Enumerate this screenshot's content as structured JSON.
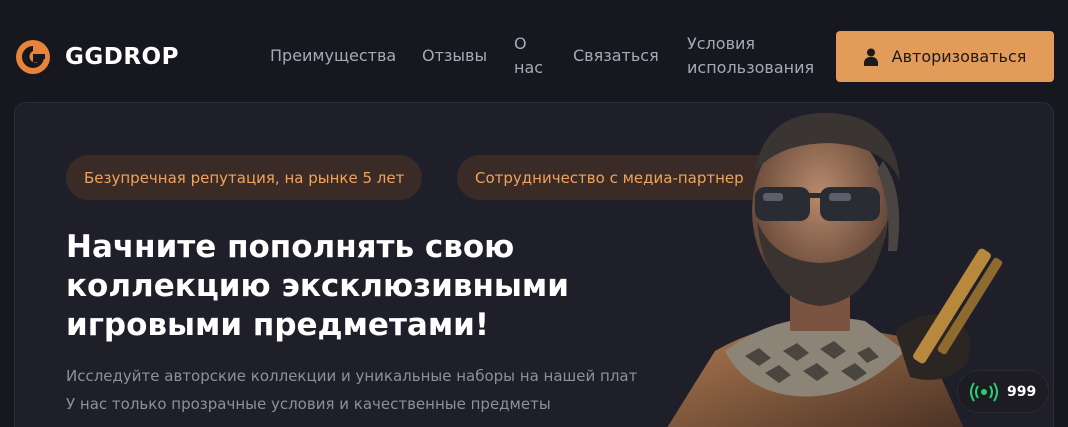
{
  "brand": {
    "name": "GGDROP",
    "accent": "#e39b5a"
  },
  "nav": {
    "advantages": "Преимущества",
    "reviews": "Отзывы",
    "about_line1": "О",
    "about_line2": "нас",
    "contact": "Связаться",
    "terms_line1": "Условия",
    "terms_line2": "использования"
  },
  "login": {
    "label": "Авторизоваться",
    "icon": "user-icon"
  },
  "hero": {
    "badges": [
      "Безупречная репутация, на рынке 5 лет",
      "Сотрудничество с медиа-партнер"
    ],
    "headline": [
      "Начните пополнять свою",
      "коллекцию эксклюзивными",
      "игровыми предметами!"
    ],
    "subtext": [
      "Исследуйте авторские коллекции и уникальные наборы на нашей плат",
      "У нас только прозрачные условия и качественные предметы"
    ]
  },
  "online": {
    "icon": "broadcast-icon",
    "count": "999",
    "color": "#2ecc71"
  }
}
